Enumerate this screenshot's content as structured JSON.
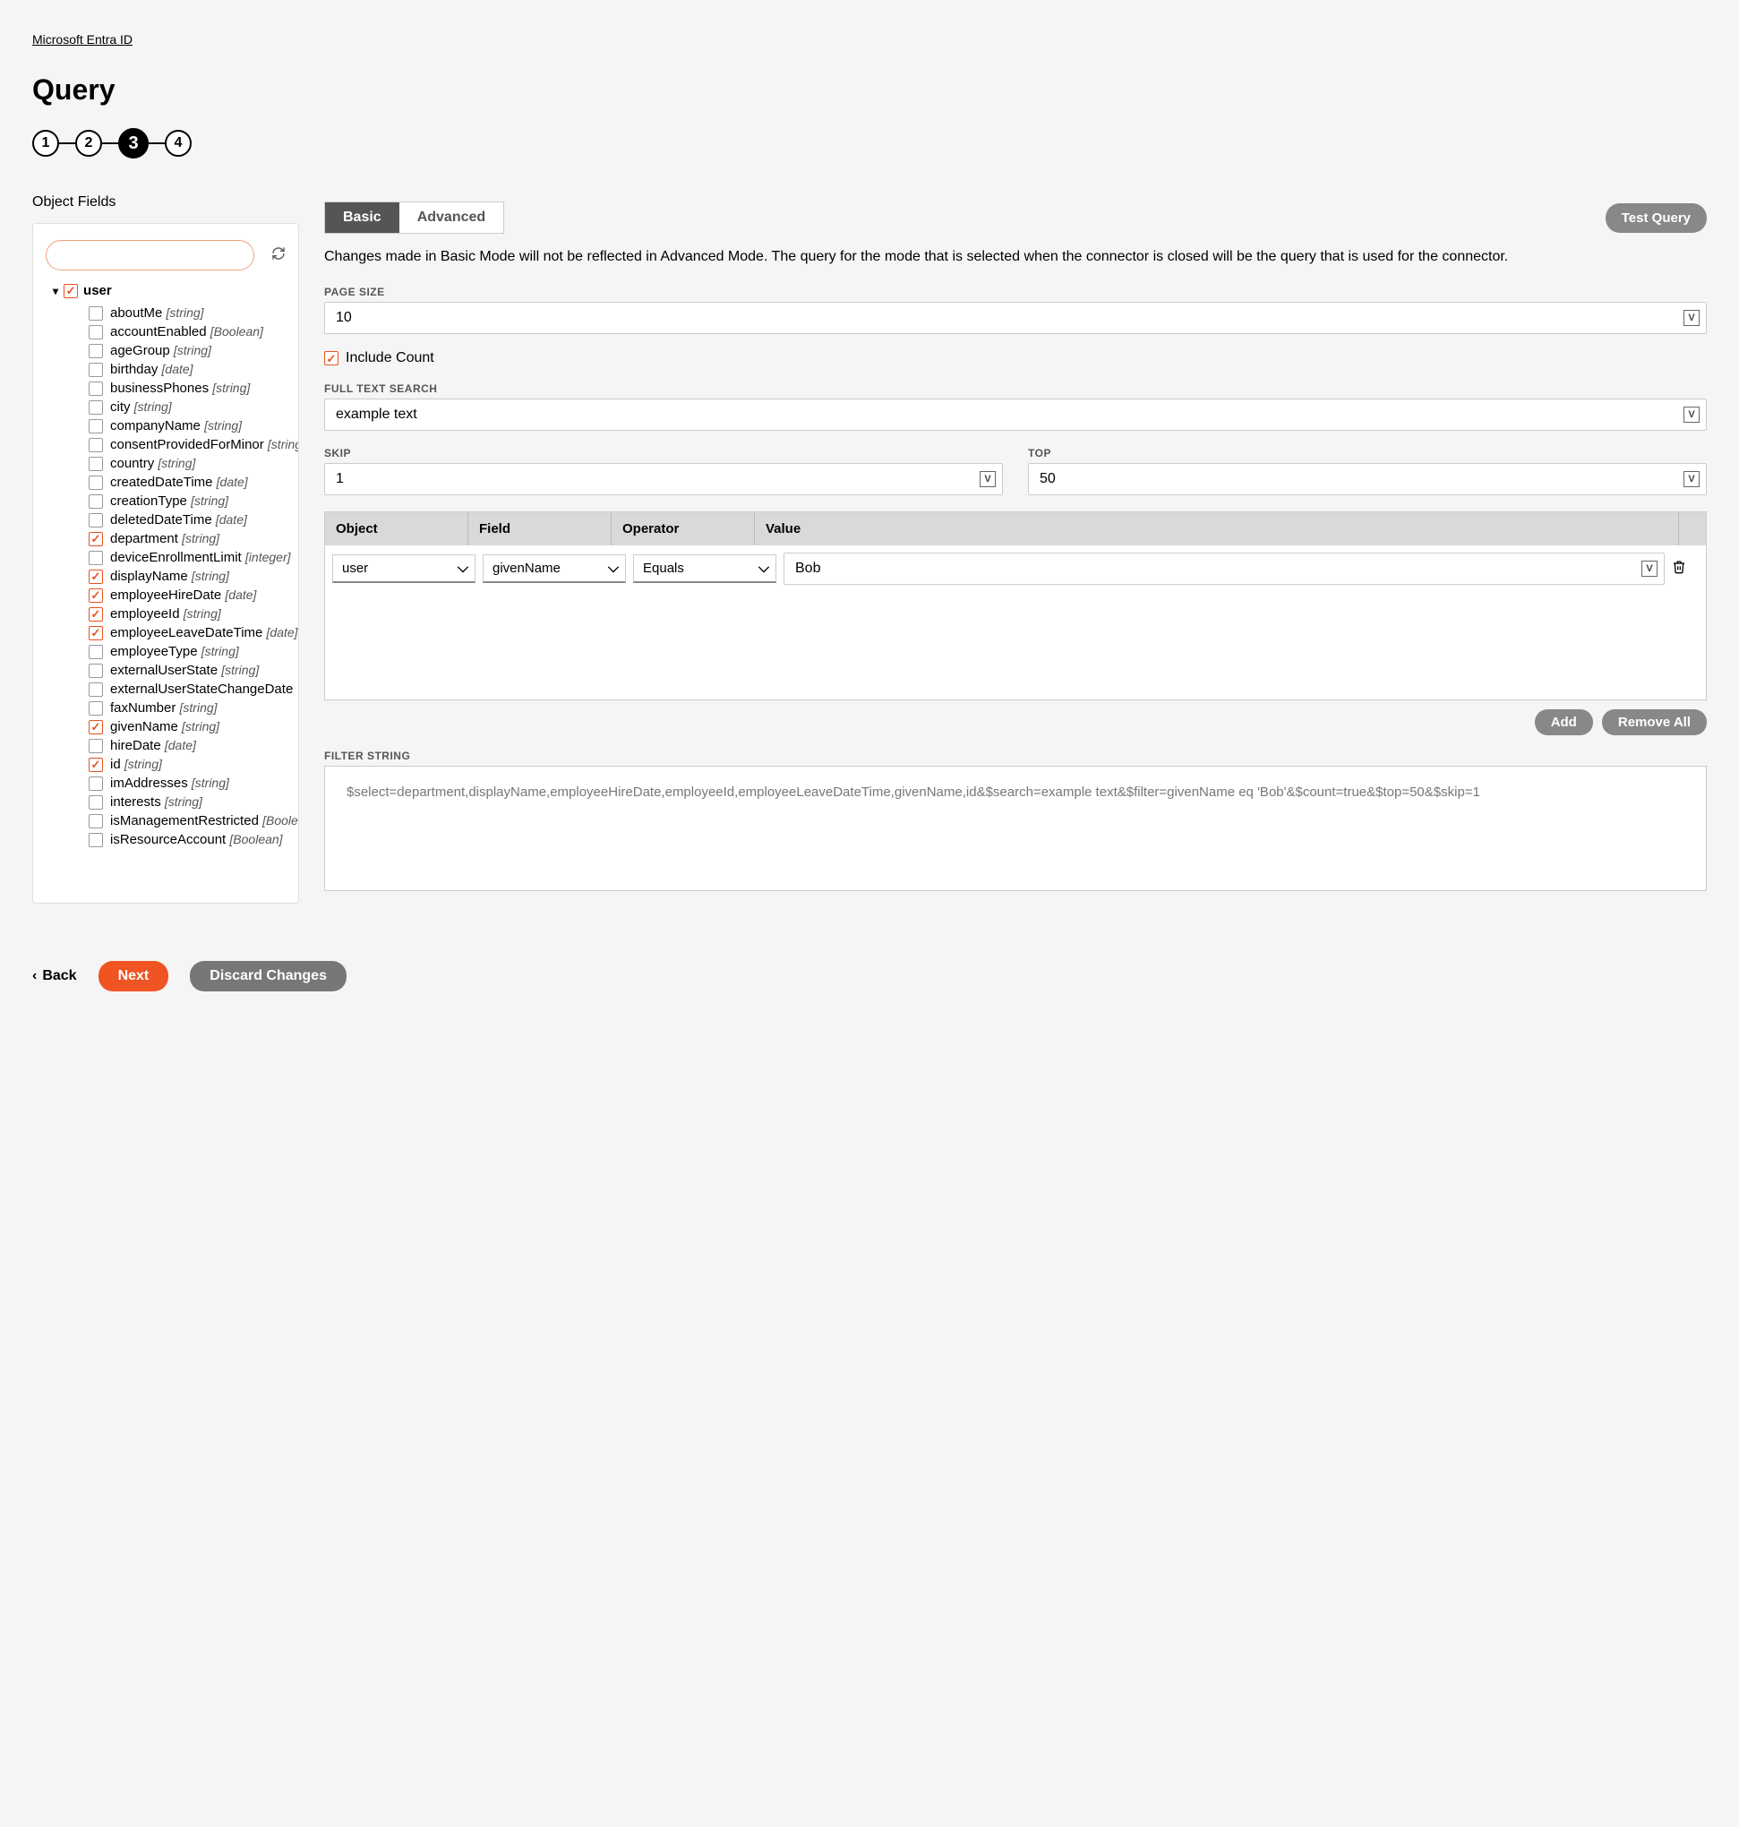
{
  "breadcrumb": "Microsoft Entra ID",
  "title": "Query",
  "stepper": {
    "steps": [
      "1",
      "2",
      "3",
      "4"
    ],
    "active": 3
  },
  "leftPanel": {
    "label": "Object Fields",
    "searchPlaceholder": "",
    "root": "user",
    "fields": [
      {
        "name": "aboutMe",
        "type": "[string]",
        "checked": false
      },
      {
        "name": "accountEnabled",
        "type": "[Boolean]",
        "checked": false
      },
      {
        "name": "ageGroup",
        "type": "[string]",
        "checked": false
      },
      {
        "name": "birthday",
        "type": "[date]",
        "checked": false
      },
      {
        "name": "businessPhones",
        "type": "[string]",
        "checked": false
      },
      {
        "name": "city",
        "type": "[string]",
        "checked": false
      },
      {
        "name": "companyName",
        "type": "[string]",
        "checked": false
      },
      {
        "name": "consentProvidedForMinor",
        "type": "[string]",
        "checked": false
      },
      {
        "name": "country",
        "type": "[string]",
        "checked": false
      },
      {
        "name": "createdDateTime",
        "type": "[date]",
        "checked": false
      },
      {
        "name": "creationType",
        "type": "[string]",
        "checked": false
      },
      {
        "name": "deletedDateTime",
        "type": "[date]",
        "checked": false
      },
      {
        "name": "department",
        "type": "[string]",
        "checked": true
      },
      {
        "name": "deviceEnrollmentLimit",
        "type": "[integer]",
        "checked": false
      },
      {
        "name": "displayName",
        "type": "[string]",
        "checked": true
      },
      {
        "name": "employeeHireDate",
        "type": "[date]",
        "checked": true
      },
      {
        "name": "employeeId",
        "type": "[string]",
        "checked": true
      },
      {
        "name": "employeeLeaveDateTime",
        "type": "[date]",
        "checked": true
      },
      {
        "name": "employeeType",
        "type": "[string]",
        "checked": false
      },
      {
        "name": "externalUserState",
        "type": "[string]",
        "checked": false
      },
      {
        "name": "externalUserStateChangeDate",
        "type": "",
        "checked": false
      },
      {
        "name": "faxNumber",
        "type": "[string]",
        "checked": false
      },
      {
        "name": "givenName",
        "type": "[string]",
        "checked": true
      },
      {
        "name": "hireDate",
        "type": "[date]",
        "checked": false
      },
      {
        "name": "id",
        "type": "[string]",
        "checked": true
      },
      {
        "name": "imAddresses",
        "type": "[string]",
        "checked": false
      },
      {
        "name": "interests",
        "type": "[string]",
        "checked": false
      },
      {
        "name": "isManagementRestricted",
        "type": "[Boolean]",
        "checked": false
      },
      {
        "name": "isResourceAccount",
        "type": "[Boolean]",
        "checked": false
      }
    ]
  },
  "tabs": {
    "basic": "Basic",
    "advanced": "Advanced"
  },
  "testQueryLabel": "Test Query",
  "infoText": "Changes made in Basic Mode will not be reflected in Advanced Mode. The query for the mode that is selected when the connector is closed will be the query that is used for the connector.",
  "form": {
    "pageSizeLabel": "PAGE SIZE",
    "pageSize": "10",
    "includeCountLabel": "Include Count",
    "includeCountChecked": true,
    "fullTextLabel": "FULL TEXT SEARCH",
    "fullText": "example text",
    "skipLabel": "SKIP",
    "skip": "1",
    "topLabel": "TOP",
    "top": "50"
  },
  "filterTable": {
    "headers": {
      "object": "Object",
      "field": "Field",
      "operator": "Operator",
      "value": "Value"
    },
    "rows": [
      {
        "object": "user",
        "field": "givenName",
        "operator": "Equals",
        "value": "Bob"
      }
    ],
    "addLabel": "Add",
    "removeAllLabel": "Remove All"
  },
  "filterString": {
    "label": "FILTER STRING",
    "value": "$select=department,displayName,employeeHireDate,employeeId,employeeLeaveDateTime,givenName,id&$search=example text&$filter=givenName eq 'Bob'&$count=true&$top=50&$skip=1"
  },
  "footer": {
    "back": "Back",
    "next": "Next",
    "discard": "Discard Changes"
  }
}
